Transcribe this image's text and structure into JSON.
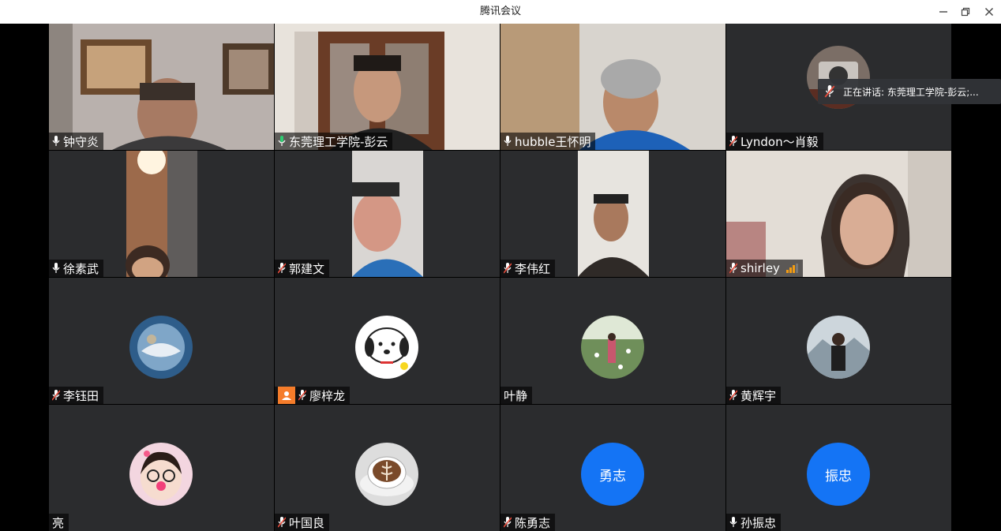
{
  "window": {
    "title": "腾讯会议",
    "minimize_icon": "minimize-icon",
    "restore_icon": "restore-icon",
    "close_icon": "close-icon"
  },
  "participants": [
    {
      "name": "钟守炎",
      "mic": "on",
      "view": "video"
    },
    {
      "name": "东莞理工学院-彭云",
      "mic": "on",
      "view": "video",
      "active": true
    },
    {
      "name": "hubble王怀明",
      "mic": "on",
      "view": "video"
    },
    {
      "name": "Lyndon～肖毅",
      "mic": "muted",
      "view": "avatar"
    },
    {
      "name": "徐素武",
      "mic": "on",
      "view": "video"
    },
    {
      "name": "郭建文",
      "mic": "muted",
      "view": "video"
    },
    {
      "name": "李伟红",
      "mic": "muted",
      "view": "video"
    },
    {
      "name": "shirley",
      "mic": "muted",
      "view": "video",
      "signal": true
    },
    {
      "name": "李钰田",
      "mic": "muted",
      "view": "avatar"
    },
    {
      "name": "廖梓龙",
      "mic": "muted",
      "view": "avatar",
      "user_icon": true
    },
    {
      "name": "叶静",
      "mic": "none",
      "view": "avatar"
    },
    {
      "name": "黄辉宇",
      "mic": "muted",
      "view": "avatar"
    },
    {
      "name": "亮",
      "mic": "none",
      "view": "avatar"
    },
    {
      "name": "叶国良",
      "mic": "muted",
      "view": "avatar"
    },
    {
      "name": "陈勇志",
      "mic": "muted",
      "view": "text-avatar",
      "avatar_text": "勇志"
    },
    {
      "name": "孙振忠",
      "mic": "on",
      "view": "text-avatar",
      "avatar_text": "振忠"
    }
  ],
  "speaking_toast": {
    "text": "正在讲话: 东莞理工学院-彭云;..."
  },
  "colors": {
    "accent": "#1474f5",
    "active_border": "#2ecc71",
    "tile_bg": "#2b2c2e",
    "muted_red": "#e74c3c"
  }
}
